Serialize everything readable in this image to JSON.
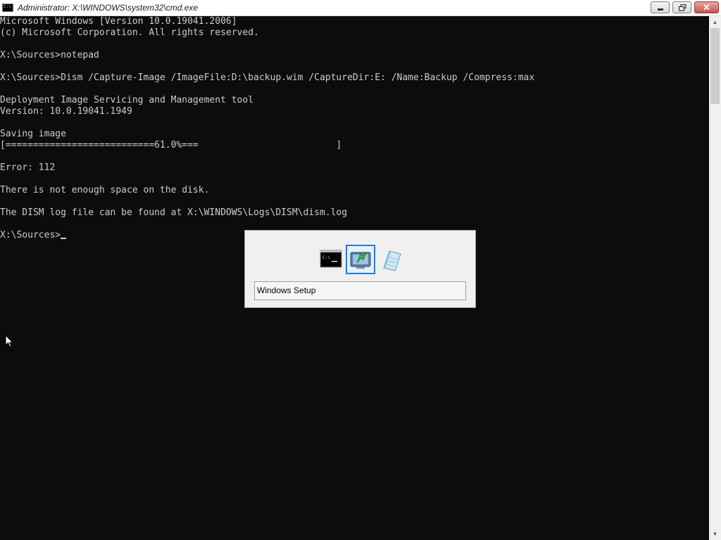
{
  "window": {
    "title": "Administrator: X:\\WINDOWS\\system32\\cmd.exe",
    "icon_text": "C:\\",
    "close_glyph": "✕"
  },
  "console": {
    "lines": [
      "Microsoft Windows [Version 10.0.19041.2006]",
      "(c) Microsoft Corporation. All rights reserved.",
      "",
      "X:\\Sources>notepad",
      "",
      "X:\\Sources>Dism /Capture-Image /ImageFile:D:\\backup.wim /CaptureDir:E: /Name:Backup /Compress:max",
      "",
      "Deployment Image Servicing and Management tool",
      "Version: 10.0.19041.1949",
      "",
      "Saving image",
      "[===========================61.0%===                         ]",
      "",
      "Error: 112",
      "",
      "There is not enough space on the disk.",
      "",
      "The DISM log file can be found at X:\\WINDOWS\\Logs\\DISM\\dism.log",
      "",
      "X:\\Sources>"
    ]
  },
  "switcher": {
    "items": [
      "cmd-icon",
      "windows-setup-icon",
      "notepad-icon"
    ],
    "selected_index": 1,
    "label": "Windows Setup"
  },
  "colors": {
    "console_bg": "#0c0c0c",
    "console_fg": "#cccccc",
    "selection": "#2a7bd6"
  }
}
